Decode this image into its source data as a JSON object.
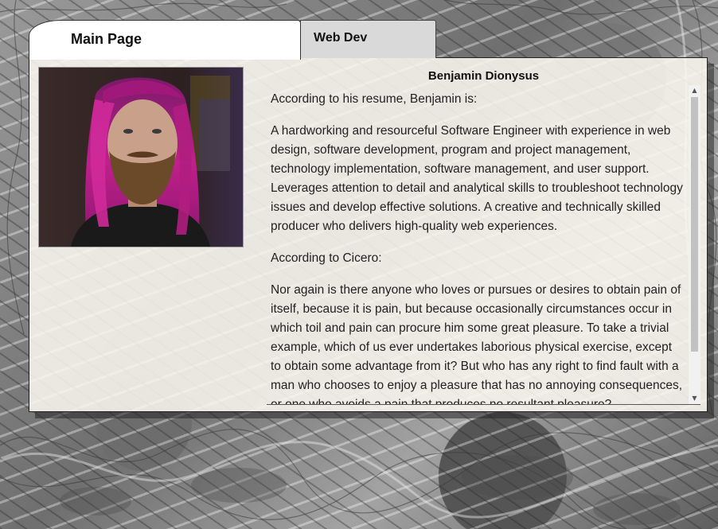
{
  "tabs": {
    "main_label": "Main Page",
    "webdev_label": "Web Dev"
  },
  "profile": {
    "name": "Benjamin Dionysus",
    "photo_alt": "portrait-photo"
  },
  "content": {
    "paragraphs": [
      "According to his resume, Benjamin is:",
      "A hardworking and resourceful Software Engineer with experience in web design, software development, program and project management, technology implementation, software management, and user support. Leverages attention to detail and analytical skills to troubleshoot technology issues and develop effective solutions. A creative and technically skilled producer who delivers high-quality web experiences.",
      "According to Cicero:",
      "Nor again is there anyone who loves or pursues or desires to obtain pain of itself, because it is pain, but because occasionally circumstances occur in which toil and pain can procure him some great pleasure. To take a trivial example, which of us ever undertakes laborious physical exercise, except to obtain some advantage from it? But who has any right to find fault with a man who chooses to enjoy a pleasure that has no annoying consequences, or one who avoids a pain that produces no resultant pleasure?"
    ]
  },
  "scrollbar": {
    "up_icon": "▲",
    "down_icon": "▼"
  },
  "colors": {
    "panel_bg": "#faf7f0",
    "tab_active": "#ffffff",
    "tab_inactive": "#d9d9d9",
    "hair": "#c0208a"
  }
}
